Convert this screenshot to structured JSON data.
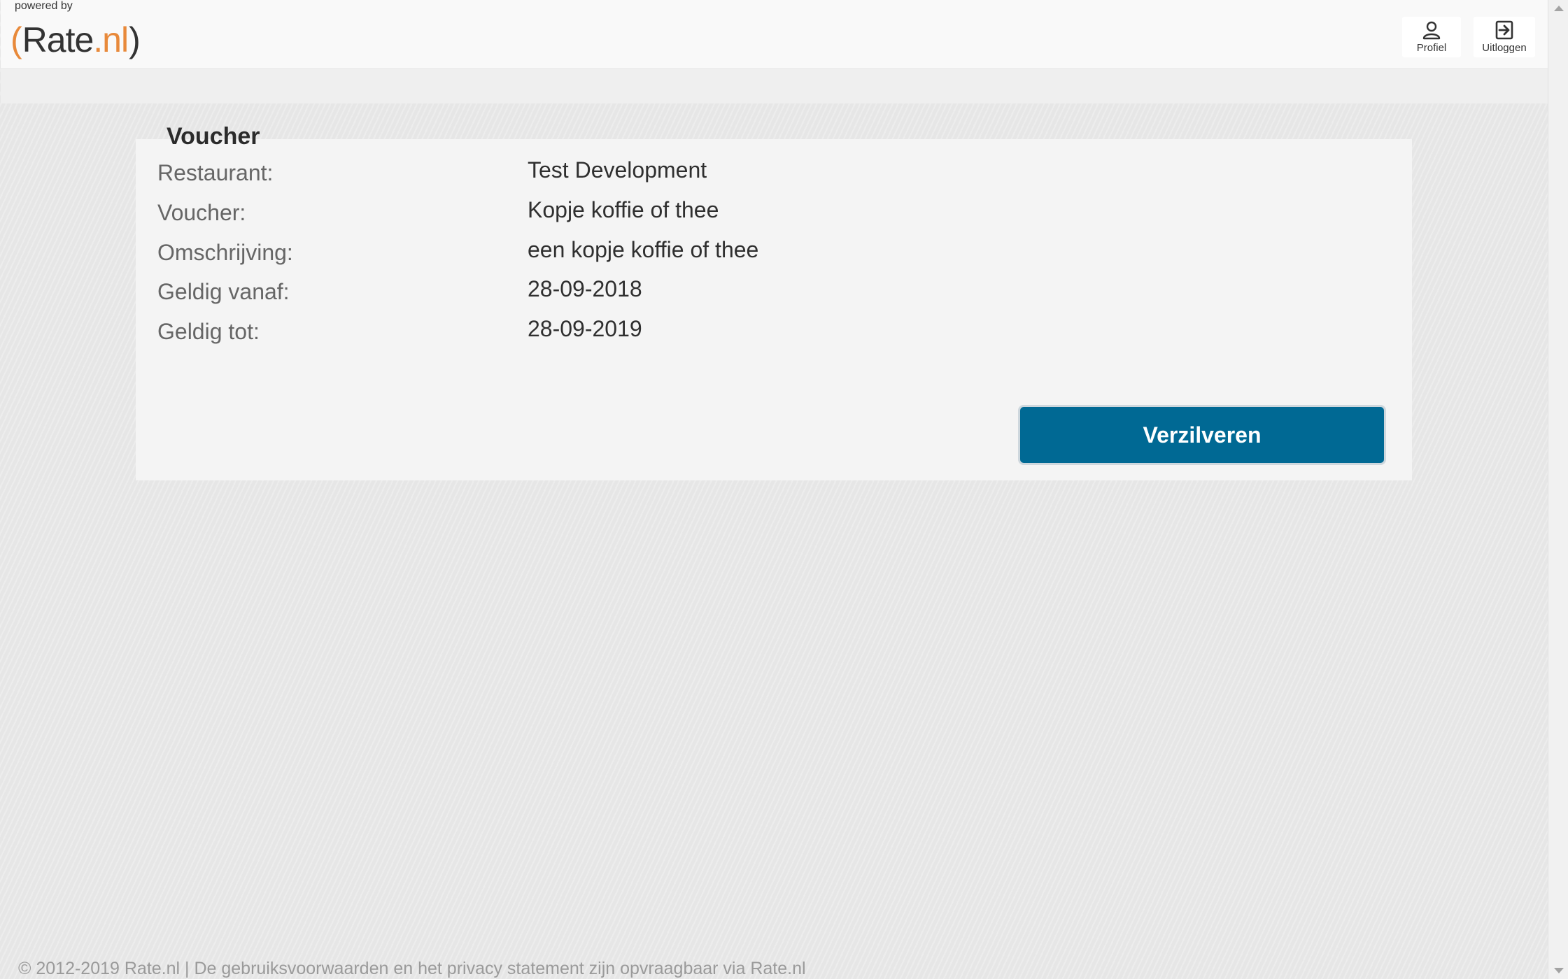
{
  "header": {
    "powered_by": "powered by",
    "logo": {
      "bracket_left": "(",
      "name": "Rate",
      "dot_nl": ".nl",
      "bracket_right": ")"
    },
    "profile_label": "Profiel",
    "logout_label": "Uitloggen"
  },
  "voucher": {
    "title": "Voucher",
    "rows": [
      {
        "label": "Restaurant:",
        "value": "Test Development"
      },
      {
        "label": "Voucher:",
        "value": "Kopje koffie of thee"
      },
      {
        "label": "Omschrijving:",
        "value": "een kopje koffie of thee"
      },
      {
        "label": "Geldig vanaf:",
        "value": "28-09-2018"
      },
      {
        "label": "Geldig tot:",
        "value": "28-09-2019"
      }
    ],
    "redeem_label": "Verzilveren",
    "redeem_color": "#006994"
  },
  "footer": {
    "text": "© 2012-2019 Rate.nl | De gebruiksvoorwaarden en het privacy statement zijn opvraagbaar via Rate.nl"
  }
}
